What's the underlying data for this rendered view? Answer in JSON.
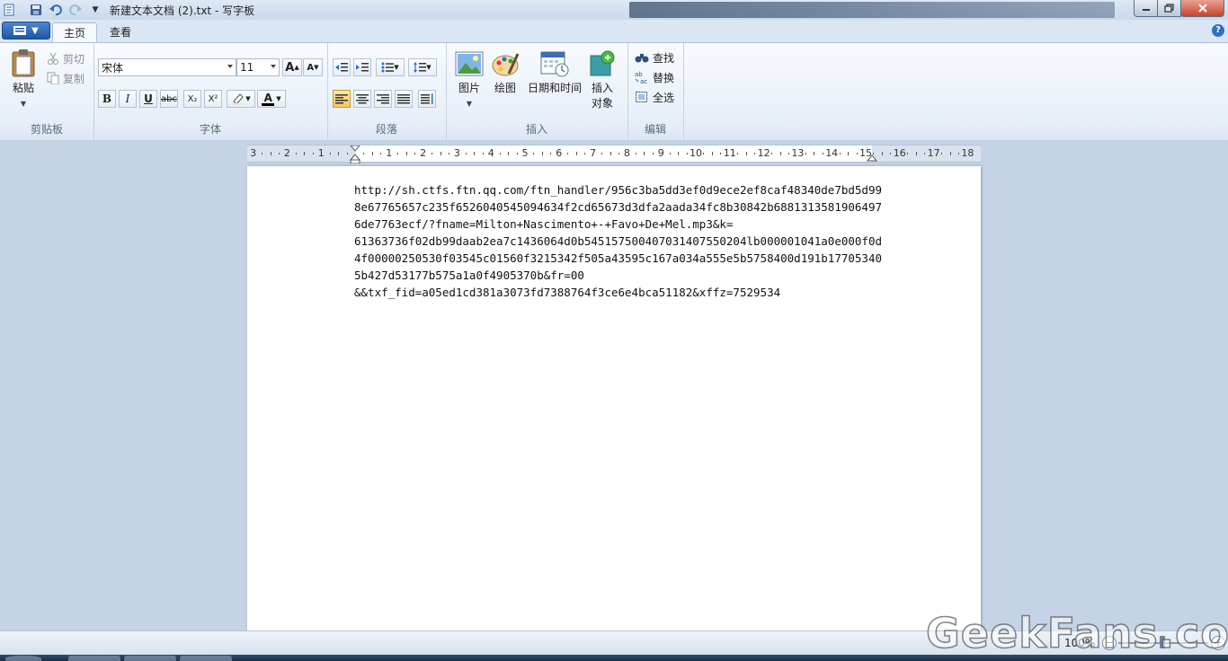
{
  "window": {
    "title": "新建文本文档 (2).txt - 写字板"
  },
  "tabs": [
    {
      "label": "主页"
    },
    {
      "label": "查看"
    }
  ],
  "clipboard": {
    "paste": "粘贴",
    "cut": "剪切",
    "copy": "复制",
    "label": "剪贴板"
  },
  "font": {
    "family": "宋体",
    "size": "11",
    "label": "字体",
    "bold": "B",
    "italic": "I",
    "underline": "U",
    "strike": "abc",
    "subscript": "X₂",
    "superscript": "X²",
    "grow": "A",
    "shrink": "A",
    "color": "A"
  },
  "paragraph": {
    "label": "段落"
  },
  "insert": {
    "picture": "图片",
    "paint": "绘图",
    "datetime": "日期和时间",
    "object_line1": "插入",
    "object_line2": "对象",
    "label": "插入"
  },
  "editing": {
    "find": "查找",
    "replace": "替换",
    "select_all": "全选",
    "label": "编辑"
  },
  "ruler": {
    "labels": [
      "3",
      "2",
      "1",
      "1",
      "2",
      "3",
      "4",
      "5",
      "6",
      "7",
      "8",
      "9",
      "10",
      "11",
      "12",
      "13",
      "14",
      "15",
      "16",
      "17",
      "18"
    ]
  },
  "document": {
    "lines": [
      "http://sh.ctfs.ftn.qq.com/ftn_handler/956c3ba5dd3ef0d9ece2ef8caf48340de7bd5d99",
      "8e67765657c235f6526040545094634f2cd65673d3dfa2aada34fc8b30842b6881313581906497",
      "6de7763ecf/?fname=Milton+Nascimento+-+Favo+De+Mel.mp3&k=",
      "61363736f02db99daab2ea7c1436064d0b545157500407031407550204lb000001041a0e000f0d",
      "4f00000250530f03545c01560f3215342f505a43595c167a034a555e5b5758400d191b17705340",
      "5b427d53177b575a1a0f4905370b&fr=00",
      "&&txf_fid=a05ed1cd381a3073fd7388764f3ce6e4bca51182&xffz=7529534"
    ]
  },
  "status": {
    "zoom": "100%"
  },
  "watermark": "GeekFans.com",
  "colors": {
    "accent": "#1c57a8",
    "close": "#c8432c",
    "active_button": "#f7c85a"
  }
}
